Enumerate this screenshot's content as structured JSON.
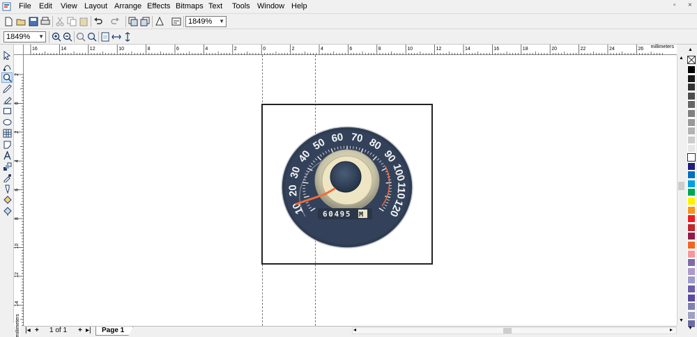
{
  "menu": {
    "items": [
      "File",
      "Edit",
      "View",
      "Layout",
      "Arrange",
      "Effects",
      "Bitmaps",
      "Text",
      "Tools",
      "Window",
      "Help"
    ]
  },
  "toolbar": {
    "zoom_value": "1849%",
    "zoom_value_2": "1849%"
  },
  "rulers": {
    "unit": "millimeters",
    "h_labels": [
      "16",
      "14",
      "12",
      "10",
      "8",
      "6",
      "4",
      "2",
      "0",
      "2",
      "4",
      "6",
      "8",
      "10",
      "12",
      "14",
      "16",
      "18",
      "20",
      "22",
      "24",
      "26"
    ],
    "v_labels": [
      "2",
      "0",
      "2",
      "4",
      "6",
      "8",
      "10",
      "12",
      "14"
    ],
    "v_unit": "millimeters"
  },
  "document": {
    "speedo_numbers": [
      "10",
      "20",
      "30",
      "40",
      "50",
      "60",
      "70",
      "80",
      "90",
      "100",
      "110",
      "120"
    ],
    "odometer": "60495",
    "odometer_unit": "M"
  },
  "pages": {
    "counter": "1 of 1",
    "tab_label": "Page 1"
  },
  "palette": [
    "#000000",
    "#1a1a1a",
    "#333333",
    "#4d4d4d",
    "#666666",
    "#808080",
    "#999999",
    "#b3b3b3",
    "#cccccc",
    "#e6e6e6",
    "#ffffff",
    "#1f1f7a",
    "#0070c0",
    "#00a0e0",
    "#00a651",
    "#fff200",
    "#f7941d",
    "#ed1c24",
    "#c1272d",
    "#8b1f4a",
    "#f26522",
    "#f5989d",
    "#7b6ba8",
    "#a99ccc",
    "#9e9ac8",
    "#6a5fa8",
    "#5c4b9c",
    "#8080b0",
    "#a0a0c8",
    "#6c6ca0"
  ]
}
